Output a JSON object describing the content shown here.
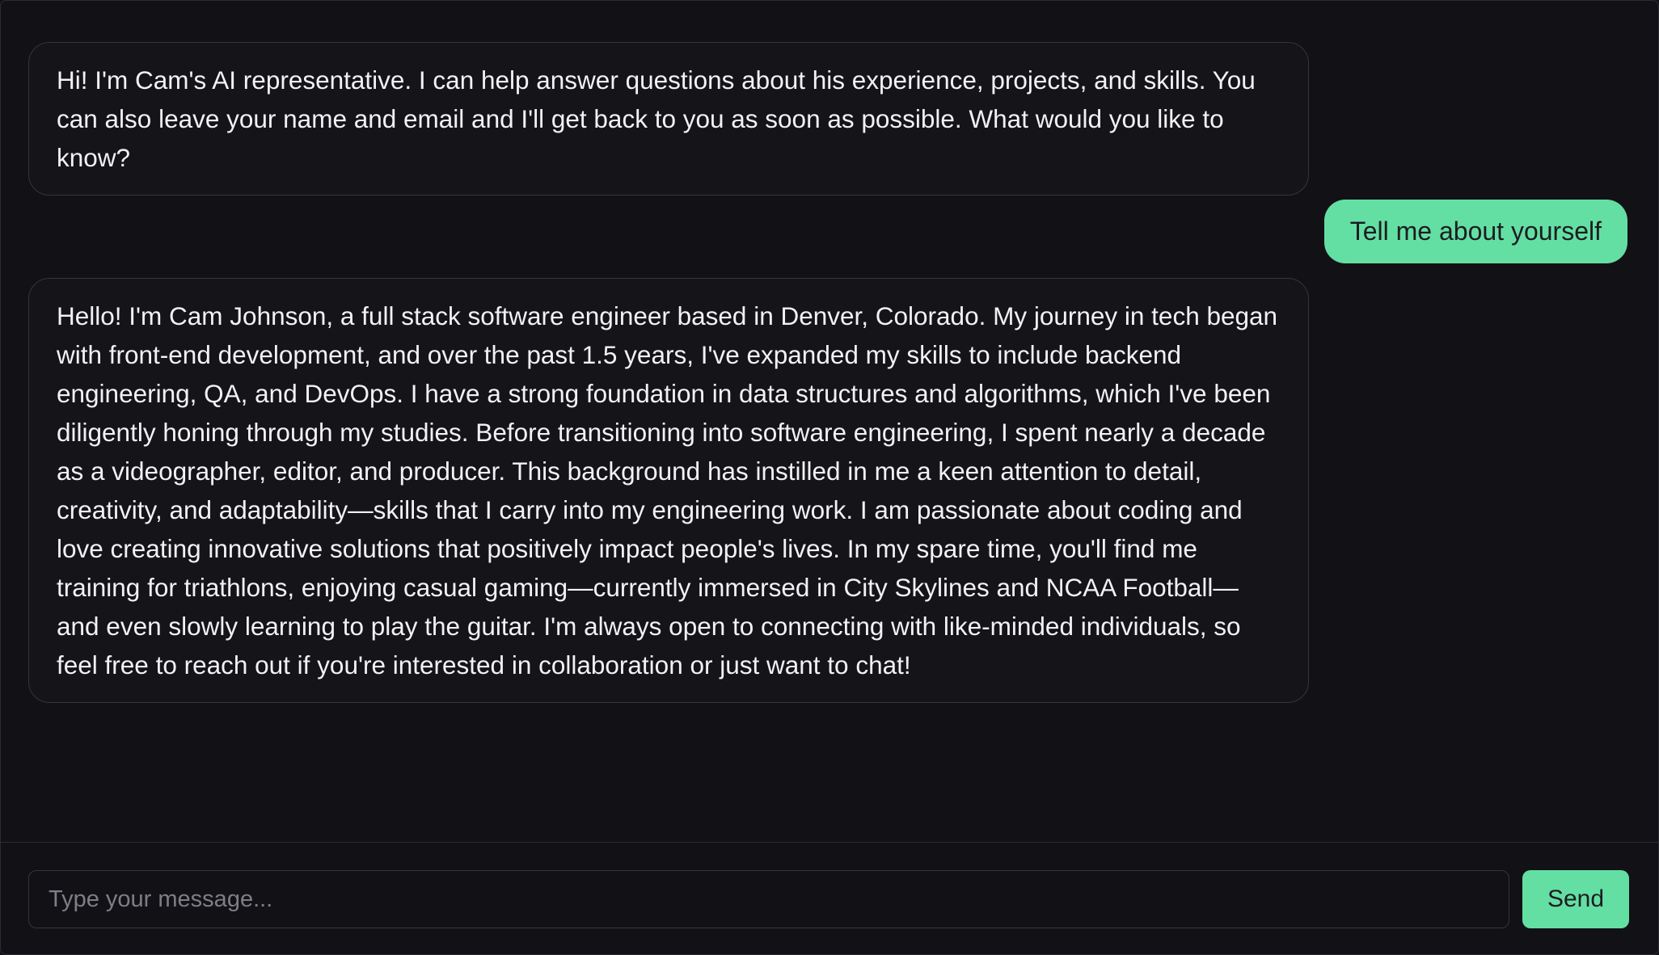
{
  "chat": {
    "messages": [
      {
        "role": "assistant",
        "text": "Hi! I'm Cam's AI representative. I can help answer questions about his experience, projects, and skills. You can also leave your name and email and I'll get back to you as soon as possible. What would you like to know?"
      },
      {
        "role": "user",
        "text": "Tell me about yourself"
      },
      {
        "role": "assistant",
        "text": "Hello! I'm Cam Johnson, a full stack software engineer based in Denver, Colorado. My journey in tech began with front-end development, and over the past 1.5 years, I've expanded my skills to include backend engineering, QA, and DevOps. I have a strong foundation in data structures and algorithms, which I've been diligently honing through my studies. Before transitioning into software engineering, I spent nearly a decade as a videographer, editor, and producer. This background has instilled in me a keen attention to detail, creativity, and adaptability—skills that I carry into my engineering work. I am passionate about coding and love creating innovative solutions that positively impact people's lives. In my spare time, you'll find me training for triathlons, enjoying casual gaming—currently immersed in City Skylines and NCAA Football—and even slowly learning to play the guitar. I'm always open to connecting with like-minded individuals, so feel free to reach out if you're interested in collaboration or just want to chat!"
      }
    ]
  },
  "composer": {
    "placeholder": "Type your message...",
    "value": "",
    "send_label": "Send"
  },
  "colors": {
    "background": "#121216",
    "accent": "#64dfa3",
    "border": "#34353d"
  }
}
